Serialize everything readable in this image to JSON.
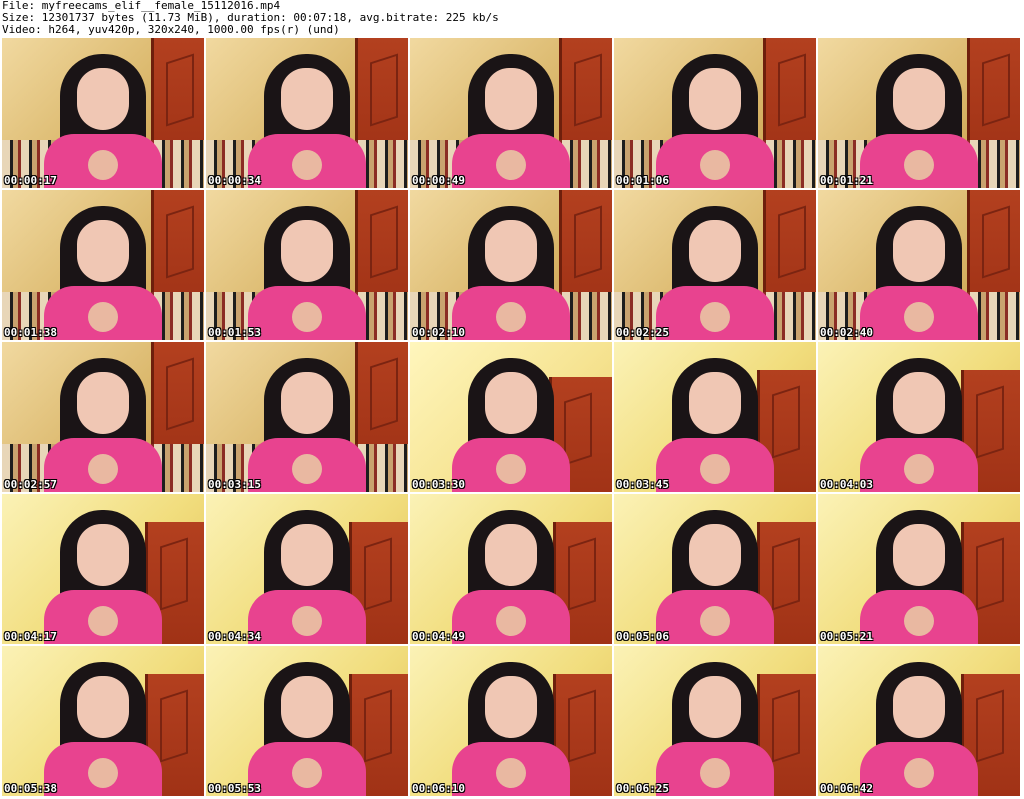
{
  "header": {
    "file_line": "File: myfreecams_elif__female_15112016.mp4",
    "size_line": "Size: 12301737 bytes (11.73 MiB), duration: 00:07:18, avg.bitrate: 225 kb/s",
    "video_line": "Video: h264, yuv420p, 320x240, 1000.00 fps(r) (und)"
  },
  "thumbnails": [
    {
      "time": "00:00:17"
    },
    {
      "time": "00:00:34"
    },
    {
      "time": "00:00:49"
    },
    {
      "time": "00:01:06"
    },
    {
      "time": "00:01:21"
    },
    {
      "time": "00:01:38"
    },
    {
      "time": "00:01:53"
    },
    {
      "time": "00:02:10"
    },
    {
      "time": "00:02:25"
    },
    {
      "time": "00:02:40"
    },
    {
      "time": "00:02:57"
    },
    {
      "time": "00:03:15"
    },
    {
      "time": "00:03:30"
    },
    {
      "time": "00:03:45"
    },
    {
      "time": "00:04:03"
    },
    {
      "time": "00:04:17"
    },
    {
      "time": "00:04:34"
    },
    {
      "time": "00:04:49"
    },
    {
      "time": "00:05:06"
    },
    {
      "time": "00:05:21"
    },
    {
      "time": "00:05:38"
    },
    {
      "time": "00:05:53"
    },
    {
      "time": "00:06:10"
    },
    {
      "time": "00:06:25"
    },
    {
      "time": "00:06:42"
    }
  ]
}
